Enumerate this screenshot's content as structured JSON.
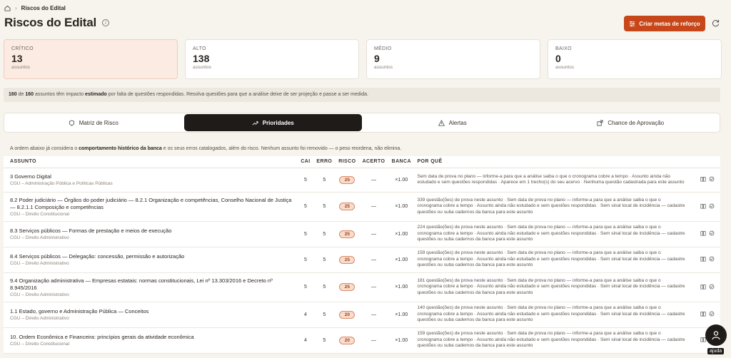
{
  "breadcrumb": {
    "current": "Riscos do Edital"
  },
  "page": {
    "title": "Riscos do Edital",
    "cta_label": "Criar metas de reforço"
  },
  "cards": [
    {
      "label": "CRÍTICO",
      "value": "13",
      "sub": "assuntos"
    },
    {
      "label": "ALTO",
      "value": "138",
      "sub": "assuntos"
    },
    {
      "label": "MÉDIO",
      "value": "9",
      "sub": "assuntos"
    },
    {
      "label": "BAIXO",
      "value": "0",
      "sub": "assuntos"
    }
  ],
  "notice": {
    "count_a": "160",
    "mid_a": " de ",
    "count_b": "160",
    "mid_b": " assuntos têm impacto ",
    "bold": "estimado",
    "rest": " por falta de questões respondidas. Resolva questões para que a análise deixe de ser projeção e passe a ser medida."
  },
  "tabs": [
    {
      "label": "Matriz de Risco",
      "icon": "shield-icon"
    },
    {
      "label": "Prioridades",
      "icon": "trend-up-icon"
    },
    {
      "label": "Alertas",
      "icon": "warning-icon"
    },
    {
      "label": "Chance de Aprovação",
      "icon": "external-icon"
    }
  ],
  "explain": {
    "pre": "A ordem abaixo já considera o ",
    "bold": "comportamento histórico da banca",
    "post": " e os seus erros catalogados, além do risco. Nenhum assunto foi removido — o peso reordena, não elimina."
  },
  "table": {
    "headers": [
      "ASSUNTO",
      "CAI",
      "ERRO",
      "RISCO",
      "ACERTO",
      "BANCA",
      "POR QUÊ"
    ],
    "rows": [
      {
        "topic": "3 Governo Digital",
        "discipline": "CGU – Administração Pública e Políticas Públicas",
        "cai": "5",
        "erro": "5",
        "risco": "25",
        "acerto": "—",
        "banca": "×1.00",
        "why": "Sem data de prova no plano — informe-a para que a análise saiba o que o cronograma cobre a tempo · Assunto ainda não estudado e sem questões respondidas · Aparece em 1 trecho(s) do seu acervo · Nenhuma questão cadastrada para este assunto"
      },
      {
        "topic": "8.2 Poder judiciário — Órgãos do poder judiciário — 8.2.1 Organização e competências, Conselho Nacional de Justiça — 8.2.1.1 Composição e competências",
        "discipline": "CGU – Direito Constitucional",
        "cai": "5",
        "erro": "5",
        "risco": "25",
        "acerto": "—",
        "banca": "×1.00",
        "why": "339 questão(ões) de prova neste assunto · Sem data de prova no plano — informe-a para que a análise saiba o que o cronograma cobre a tempo · Assunto ainda não estudado e sem questões respondidas · Sem sinal local de incidência — cadastre questões ou suba cadernos da banca para este assunto"
      },
      {
        "topic": "8.3 Serviços públicos — Formas de prestação e meios de execução",
        "discipline": "CGU – Direito Administrativo",
        "cai": "5",
        "erro": "5",
        "risco": "25",
        "acerto": "—",
        "banca": "×1.00",
        "why": "224 questão(ões) de prova neste assunto · Sem data de prova no plano — informe-a para que a análise saiba o que o cronograma cobre a tempo · Assunto ainda não estudado e sem questões respondidas · Sem sinal local de incidência — cadastre questões ou suba cadernos da banca para este assunto"
      },
      {
        "topic": "8.4 Serviços públicos — Delegação: concessão, permissão e autorização",
        "discipline": "CGU – Direito Administrativo",
        "cai": "5",
        "erro": "5",
        "risco": "25",
        "acerto": "—",
        "banca": "×1.00",
        "why": "159 questão(ões) de prova neste assunto · Sem data de prova no plano — informe-a para que a análise saiba o que o cronograma cobre a tempo · Assunto ainda não estudado e sem questões respondidas · Sem sinal local de incidência — cadastre questões ou suba cadernos da banca para este assunto"
      },
      {
        "topic": "9.4 Organização administrativa — Empresas estatais: normas constitucionais, Lei nº 13.303/2016 e Decreto nº 8.945/2016",
        "discipline": "CGU – Direito Administrativo",
        "cai": "5",
        "erro": "5",
        "risco": "25",
        "acerto": "—",
        "banca": "×1.00",
        "why": "181 questão(ões) de prova neste assunto · Sem data de prova no plano — informe-a para que a análise saiba o que o cronograma cobre a tempo · Assunto ainda não estudado e sem questões respondidas · Sem sinal local de incidência — cadastre questões ou suba cadernos da banca para este assunto"
      },
      {
        "topic": "1.1 Estado, governo e Administração Pública — Conceitos",
        "discipline": "CGU – Direito Administrativo",
        "cai": "4",
        "erro": "5",
        "risco": "20",
        "acerto": "—",
        "banca": "×1.00",
        "why": "140 questão(ões) de prova neste assunto · Sem data de prova no plano — informe-a para que a análise saiba o que o cronograma cobre a tempo · Assunto ainda não estudado e sem questões respondidas · Sem sinal local de incidência — cadastre questões ou suba cadernos da banca para este assunto"
      },
      {
        "topic": "10. Ordem Econômica e Financeira: princípios gerais da atividade econômica",
        "discipline": "CGU – Direito Constitucional",
        "cai": "4",
        "erro": "5",
        "risco": "20",
        "acerto": "—",
        "banca": "×1.00",
        "why": "159 questão(ões) de prova neste assunto · Sem data de prova no plano — informe-a para que a análise saiba o que o cronograma cobre a tempo · Assunto ainda não estudado e sem questões respondidas · Sem sinal local de incidência — cadastre questões ou suba cadernos da banca para este assunto"
      }
    ]
  },
  "help": {
    "label": "ajuda"
  },
  "colors": {
    "accent": "#c8471a",
    "dark": "#1e1b18",
    "critical_bg": "#fbebe2"
  }
}
